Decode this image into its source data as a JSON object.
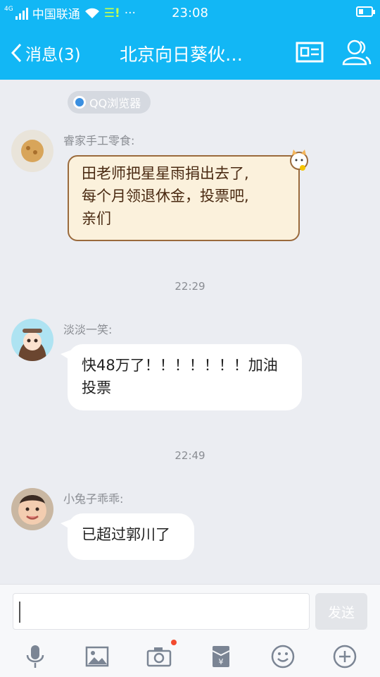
{
  "status": {
    "network_type": "4G",
    "carrier": "中国联通",
    "time": "23:08",
    "ellipsis": "···"
  },
  "nav": {
    "back_label": "消息(3)",
    "title": "北京向日葵伙…"
  },
  "chip": {
    "label": "QQ浏览器"
  },
  "messages": [
    {
      "sender": "睿家手工零食:",
      "text_lines": [
        "田老师把星星雨捐出去了,",
        "每个月领退休金，投票吧,",
        "亲们"
      ]
    },
    {
      "timestamp": "22:29",
      "sender": "淡淡一笑:",
      "text_lines": [
        "快48万了！！！！！！！加油",
        "投票"
      ]
    },
    {
      "timestamp": "22:49",
      "sender": "小兔子乖乖:",
      "text_lines": [
        "已超过郭川了"
      ]
    }
  ],
  "input": {
    "value": "",
    "send_label": "发送"
  },
  "toolbar": {
    "icons": [
      "microphone-icon",
      "image-icon",
      "camera-icon",
      "red-packet-icon",
      "emoji-icon",
      "plus-icon"
    ]
  },
  "colors": {
    "header": "#12b7f5",
    "background": "#ebedf2",
    "notification_dot": "#f24b30"
  }
}
